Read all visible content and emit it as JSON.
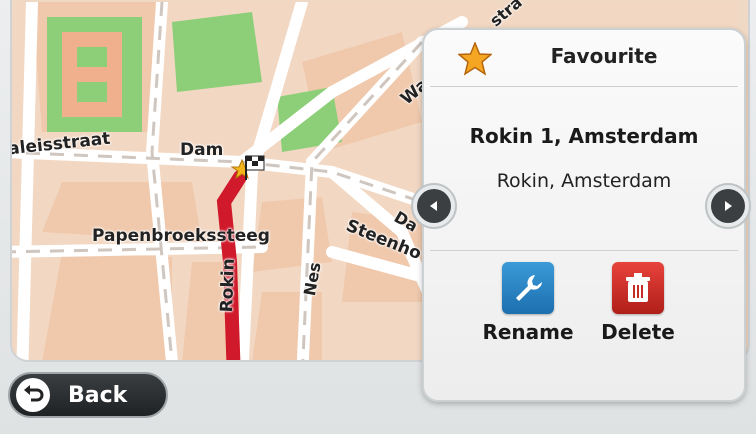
{
  "map": {
    "streets": {
      "s1": "aleisstraat",
      "s2": "Dam",
      "s3": "Papenbroekssteeg",
      "s4": "Rokin",
      "s5": "Nes",
      "s6": "Steenho",
      "s7": "Da",
      "s8": "Wa",
      "s9": "stra"
    }
  },
  "panel": {
    "title": "Favourite",
    "address_line1": "Rokin 1, Amsterdam",
    "address_line2": "Rokin, Amsterdam",
    "rename_label": "Rename",
    "delete_label": "Delete"
  },
  "footer": {
    "back_label": "Back"
  },
  "colors": {
    "route": "#d0192a",
    "park": "#8ccf78",
    "block": "#f0cdb3",
    "road": "#ffffff"
  }
}
